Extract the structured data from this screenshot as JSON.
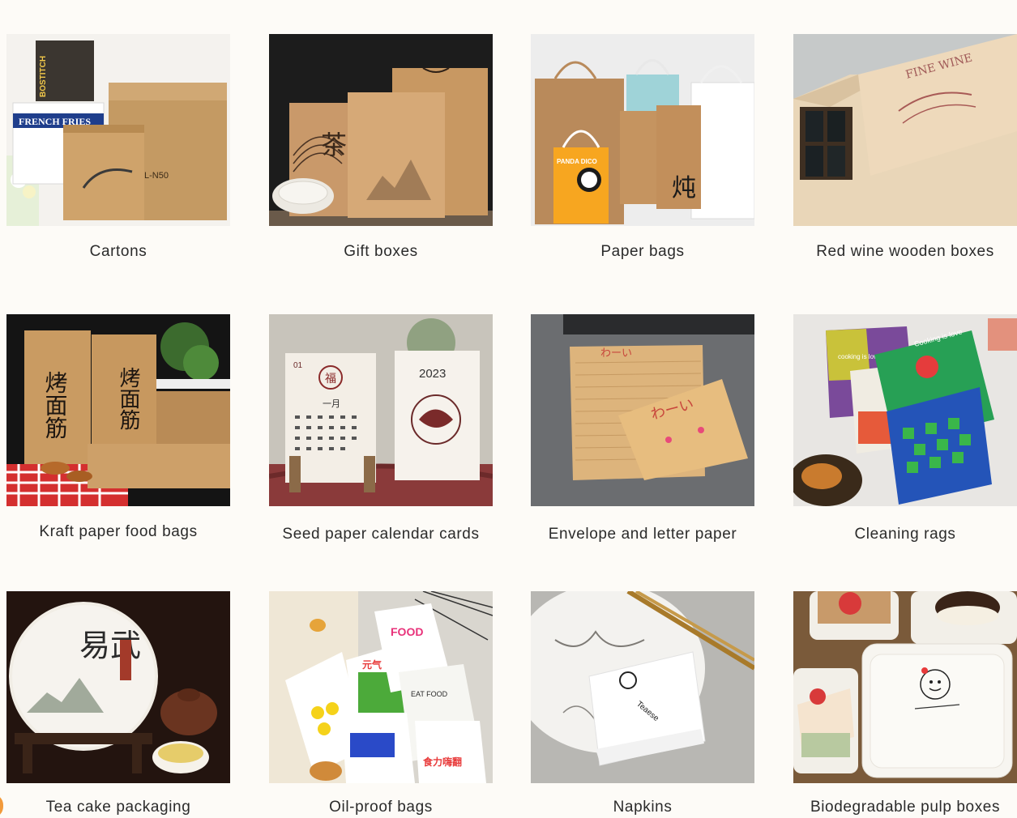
{
  "colors": {
    "page_background": "#fdfbf7",
    "caption_text": "#2b2b2b",
    "accent": "#f29a3b"
  },
  "products": [
    {
      "id": "cartons",
      "label": "Cartons",
      "icon": "carton-boxes-image"
    },
    {
      "id": "gift-boxes",
      "label": "Gift boxes",
      "icon": "gift-boxes-image"
    },
    {
      "id": "paper-bags",
      "label": "Paper bags",
      "icon": "paper-bags-image"
    },
    {
      "id": "red-wine-wooden-boxes",
      "label": "Red wine wooden boxes",
      "icon": "wine-box-image"
    },
    {
      "id": "kraft-paper-food-bags",
      "label": "Kraft paper food bags",
      "icon": "kraft-bags-image"
    },
    {
      "id": "seed-paper-calendar-cards",
      "label": "Seed paper calendar cards",
      "icon": "calendar-cards-image"
    },
    {
      "id": "envelope-and-letter-paper",
      "label": "Envelope and letter paper",
      "icon": "envelope-image"
    },
    {
      "id": "cleaning-rags",
      "label": "Cleaning rags",
      "icon": "cleaning-rags-image"
    },
    {
      "id": "tea-cake-packaging",
      "label": "Tea cake packaging",
      "icon": "tea-cake-image"
    },
    {
      "id": "oil-proof-bags",
      "label": "Oil-proof bags",
      "icon": "oil-proof-bags-image"
    },
    {
      "id": "napkins",
      "label": "Napkins",
      "icon": "napkins-image"
    },
    {
      "id": "biodegradable-pulp-boxes",
      "label": "Biodegradable pulp boxes",
      "icon": "pulp-boxes-image"
    }
  ],
  "image_text": {
    "cartons_brand": "BOSTITCH",
    "cartons_label": "FRENCH FRIES",
    "cartons_code": "L-N50",
    "gift_box_char": "茶",
    "wine_box_text": "FINE WINE",
    "paper_bag_brand": "PANDA DICO",
    "paper_bag_char": "炖",
    "kraft_bag_text": "烤面筋",
    "calendar_month": "一月",
    "calendar_day_num": "01",
    "calendar_char": "福",
    "calendar_year": "2023",
    "envelope_text": "わーい",
    "rags_text_1": "Cooking is love",
    "rags_text_2": "cooking is love",
    "tea_cake_text": "易武",
    "oilbag_text_1": "FOOD",
    "oilbag_text_2": "元气",
    "oilbag_text_3": "EAT FOOD",
    "oilbag_text_4": "食力嗨翻",
    "napkin_text": "Teaese"
  }
}
